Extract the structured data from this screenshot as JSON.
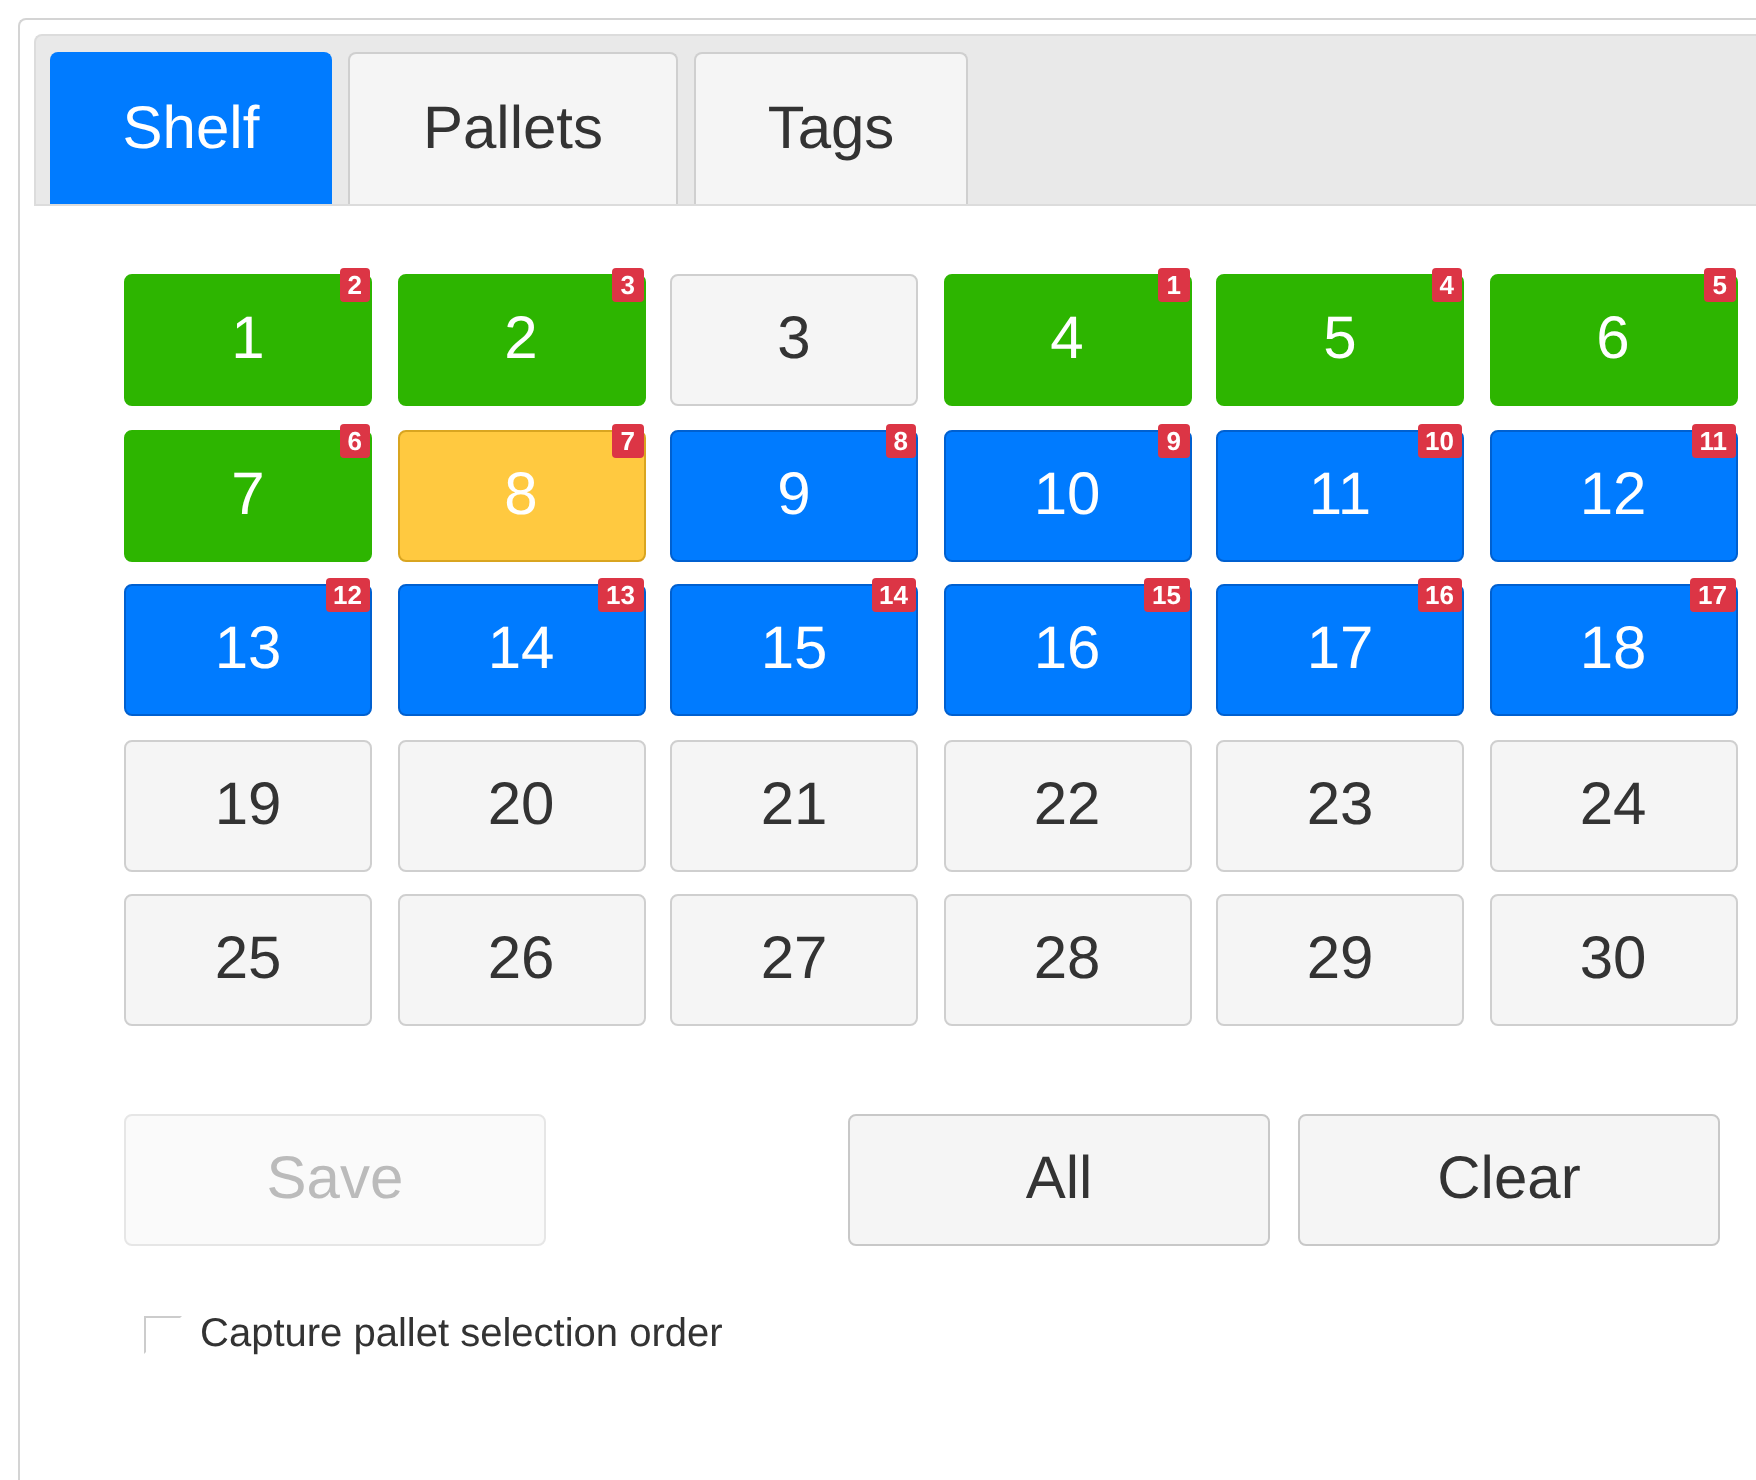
{
  "tabs": [
    {
      "label": "Shelf",
      "selected": true
    },
    {
      "label": "Pallets",
      "selected": false
    },
    {
      "label": "Tags",
      "selected": false
    }
  ],
  "slots": [
    {
      "label": "1",
      "kind": "green",
      "badge": "2"
    },
    {
      "label": "2",
      "kind": "green",
      "badge": "3"
    },
    {
      "label": "3",
      "kind": "empty"
    },
    {
      "label": "4",
      "kind": "green",
      "badge": "1"
    },
    {
      "label": "5",
      "kind": "green",
      "badge": "4"
    },
    {
      "label": "6",
      "kind": "green",
      "badge": "5"
    },
    {
      "label": "7",
      "kind": "green",
      "badge": "6"
    },
    {
      "label": "8",
      "kind": "yellow",
      "badge": "7"
    },
    {
      "label": "9",
      "kind": "blue",
      "badge": "8"
    },
    {
      "label": "10",
      "kind": "blue",
      "badge": "9"
    },
    {
      "label": "11",
      "kind": "blue",
      "badge": "10"
    },
    {
      "label": "12",
      "kind": "blue",
      "badge": "11"
    },
    {
      "label": "13",
      "kind": "blue",
      "badge": "12"
    },
    {
      "label": "14",
      "kind": "blue",
      "badge": "13"
    },
    {
      "label": "15",
      "kind": "blue",
      "badge": "14"
    },
    {
      "label": "16",
      "kind": "blue",
      "badge": "15"
    },
    {
      "label": "17",
      "kind": "blue",
      "badge": "16"
    },
    {
      "label": "18",
      "kind": "blue",
      "badge": "17"
    },
    {
      "label": "19",
      "kind": "empty"
    },
    {
      "label": "20",
      "kind": "empty"
    },
    {
      "label": "21",
      "kind": "empty"
    },
    {
      "label": "22",
      "kind": "empty"
    },
    {
      "label": "23",
      "kind": "empty"
    },
    {
      "label": "24",
      "kind": "empty"
    },
    {
      "label": "25",
      "kind": "empty"
    },
    {
      "label": "26",
      "kind": "empty"
    },
    {
      "label": "27",
      "kind": "empty"
    },
    {
      "label": "28",
      "kind": "empty"
    },
    {
      "label": "29",
      "kind": "empty"
    },
    {
      "label": "30",
      "kind": "empty"
    }
  ],
  "buttons": [
    {
      "label": "Save",
      "disabled": true
    },
    {
      "label": "All",
      "disabled": false
    },
    {
      "label": "Clear",
      "disabled": false
    }
  ],
  "checkbox": {
    "label": "Capture pallet selection order",
    "checked": false
  }
}
